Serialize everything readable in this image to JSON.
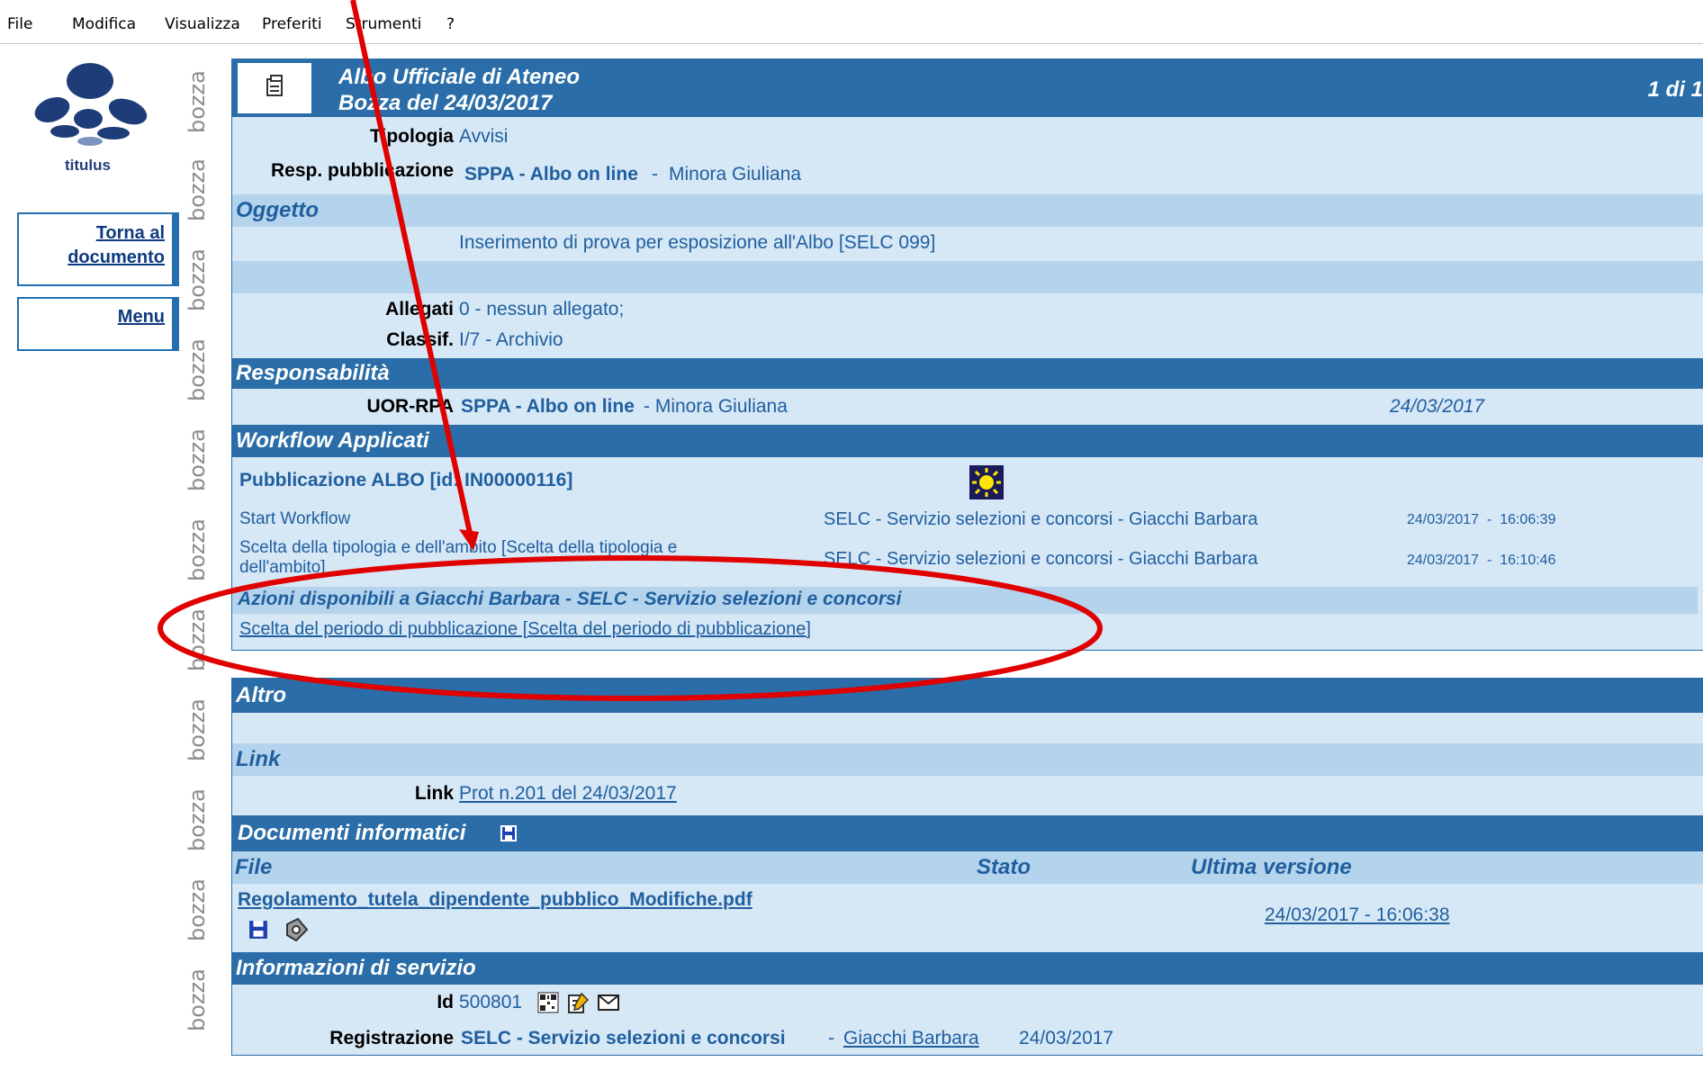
{
  "menu": [
    "File",
    "Modifica",
    "Visualizza",
    "Preferiti",
    "Strumenti",
    "?"
  ],
  "sidebar": {
    "logo_label": "titulus",
    "back_label_1": "Torna al",
    "back_label_2": "documento",
    "menu_label": "Menu",
    "watermark": "bozza"
  },
  "header": {
    "title": "Albo Ufficiale di Ateneo",
    "subtitle": "Bozza del 24/03/2017",
    "pager": "1 di 1"
  },
  "fields": {
    "tipologia_label": "Tipologia",
    "tipologia_value": "Avvisi",
    "resp_label": "Resp. pubblicazione",
    "resp_office": "SPPA - Albo on line",
    "resp_sep": "-",
    "resp_person": "Minora Giuliana"
  },
  "oggetto": {
    "title": "Oggetto",
    "text": "Inserimento di prova per esposizione all'Albo [SELC 099]"
  },
  "allegati": {
    "label": "Allegati",
    "value": "0 - nessun allegato;",
    "classif_label": "Classif.",
    "classif_value": "I/7 - Archivio"
  },
  "responsabilita": {
    "title": "Responsabilità",
    "label": "UOR-RPA",
    "office": "SPPA - Albo on line",
    "person": "- Minora Giuliana",
    "date": "24/03/2017"
  },
  "workflow": {
    "title": "Workflow Applicati",
    "name": "Pubblicazione ALBO [id: IN00000116]",
    "steps": [
      {
        "name": "Start Workflow",
        "actor": "SELC - Servizio selezioni e concorsi - Giacchi Barbara",
        "time": "24/03/2017  -  16:06:39"
      },
      {
        "name": "Scelta della tipologia e dell'ambito [Scelta della tipologia e dell'ambito]",
        "actor": "SELC - Servizio selezioni e concorsi - Giacchi Barbara",
        "time": "24/03/2017  -  16:10:46"
      }
    ],
    "actions_title": "Azioni disponibili a Giacchi Barbara - SELC - Servizio selezioni e concorsi",
    "action_link": "Scelta del periodo di pubblicazione [Scelta del periodo di pubblicazione]"
  },
  "altro": {
    "title": "Altro",
    "link_section": "Link",
    "link_label": "Link",
    "link_value": "Prot n.201 del 24/03/2017"
  },
  "documenti": {
    "title": "Documenti informatici",
    "col_file": "File",
    "col_stato": "Stato",
    "col_versione": "Ultima versione",
    "file_name": "Regolamento_tutela_dipendente_pubblico_Modifiche.pdf",
    "version": "24/03/2017 - 16:06:38"
  },
  "servizio": {
    "title": "Informazioni di servizio",
    "id_label": "Id",
    "id_value": "500801",
    "reg_label": "Registrazione",
    "reg_office": "SELC - Servizio selezioni e concorsi",
    "reg_sep": "-",
    "reg_person": "Giacchi Barbara",
    "reg_date": "24/03/2017"
  },
  "colors": {
    "header_blue": "#2a6da8",
    "light_blue": "#d6e7f6",
    "mid_blue": "#b4d3ed",
    "text_blue": "#1f5f9e",
    "annotation_red": "#e00000"
  }
}
